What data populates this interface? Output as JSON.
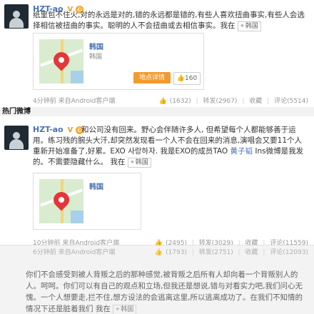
{
  "section_title": "热门微博",
  "post1": {
    "username": "HZT-ao",
    "badges": [
      "V",
      "心"
    ],
    "text": "纸里包不住火,对的永远是对的,错的永远都是错的,有些人喜欢扭曲事实,有些人会选择相信被扭曲的事实。聪明的人不会扭曲或去相信事实。我在",
    "location_tag": "韩国",
    "map_title": "韩国",
    "map_sub": "韩国",
    "map_button": "地点详情",
    "like_count": "160",
    "meta": "4分钟前  来自Android客户端",
    "actions": {
      "likes": "(1632)",
      "repost": "转发(2967)",
      "favorite": "收藏",
      "comment": "评论(5514)"
    }
  },
  "post2": {
    "username": "HZT-ao",
    "badges": [
      "V",
      "心"
    ],
    "text_a": "和公司没有回来。野心会伴随许多人, 但希望每个人都能够善于运用。练习残的腕头大汗,却突然发现看一个人不会在回来的消息,演唱会又要11个人重新开始准备了,好累。EXO 사랑하자. 我是EXO的成员TAO ",
    "mention": "黄子韬",
    "text_b": " Ins微博是我发的。不需要隐藏什么。 我在",
    "location_tag": "韩国",
    "map_title": "韩国",
    "meta": "10分钟前  来自Android客户端",
    "actions": {
      "likes": "(2495)",
      "repost": "转发(3029)",
      "favorite": "收藏",
      "comment": "评论(11559)"
    }
  },
  "post3": {
    "meta": "6分钟前  来自Android客户端",
    "actions": {
      "likes": "(1793)",
      "repost": "转发(2751)",
      "favorite": "收藏",
      "comment": "评论(12093)"
    },
    "text": "你们不会感受到被人背叛之后的那种感觉,被背叛之后所有人却向着一个背叛别人的人。呵呵。你们可以有自己的观点和立场,但我还是想说,错与对看实力吧,我们问心无愧。一个人想要走,拦不住,想方设法的会逃离这里,所以逃离成功了。在我们不知情的情况下还是脏着我们 我在",
    "location_tag": "韩国"
  }
}
